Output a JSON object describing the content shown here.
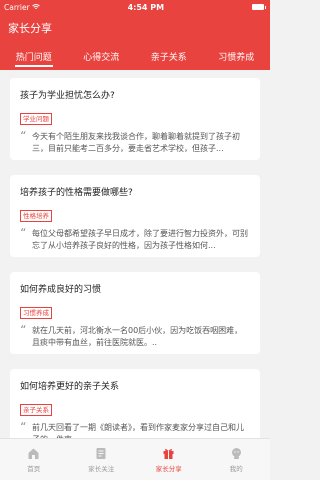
{
  "status_bar": {
    "carrier": "Carrier",
    "time": "4:54 PM"
  },
  "header": {
    "title": "家长分享"
  },
  "tabs": [
    {
      "label": "热门问题",
      "active": true
    },
    {
      "label": "心得交流",
      "active": false
    },
    {
      "label": "亲子关系",
      "active": false
    },
    {
      "label": "习惯养成",
      "active": false
    }
  ],
  "cards": [
    {
      "title": "孩子为学业担忧怎么办?",
      "tag": "学业问题",
      "excerpt": "今天有个陌生朋友来找我谈合作，聊着聊着就提到了孩子初三，目前只能考二百多分，要走省艺术学校，但孩子..."
    },
    {
      "title": "培养孩子的性格需要做哪些?",
      "tag": "性格培养",
      "excerpt": "每位父母都希望孩子早日成才，除了要进行智力投资外，可别忘了从小培养孩子良好的性格，因为孩子性格如何..."
    },
    {
      "title": "如何养成良好的习惯",
      "tag": "习惯养成",
      "excerpt": "就在几天前，河北衡水一名00后小伙，因为吃饭吞咽困难，且痰中带有血丝，前往医院就医。.."
    },
    {
      "title": "如何培养更好的亲子关系",
      "tag": "亲子关系",
      "excerpt": "前几天回看了一期《朗读者》，看到作家麦家分享过自己和儿子的一件事。..."
    }
  ],
  "bottom_nav": [
    {
      "label": "首页",
      "icon": "home-icon",
      "active": false
    },
    {
      "label": "家长关注",
      "icon": "document-icon",
      "active": false
    },
    {
      "label": "家长分享",
      "icon": "gift-icon",
      "active": true
    },
    {
      "label": "我的",
      "icon": "profile-icon",
      "active": false
    }
  ],
  "colors": {
    "accent": "#e8433f",
    "inactive": "#999999"
  }
}
